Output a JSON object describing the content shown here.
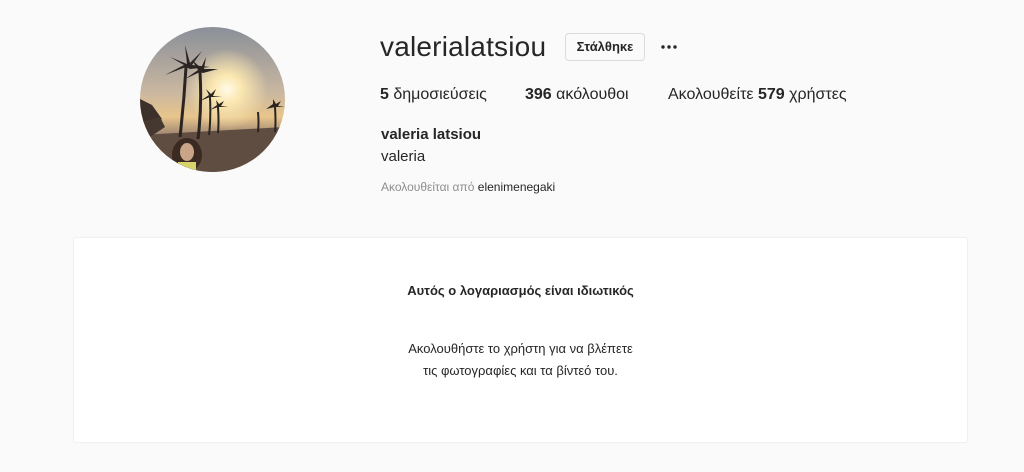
{
  "profile": {
    "username": "valerialatsiou",
    "sent_button_label": "Στάλθηκε",
    "more_icon": "more-horizontal-icon",
    "stats": {
      "posts_count": "5",
      "posts_label": "δημοσιεύσεις",
      "followers_count": "396",
      "followers_label": "ακόλουθοι",
      "following_prefix": "Ακολουθείτε",
      "following_count": "579",
      "following_suffix": "χρήστες"
    },
    "full_name": "valeria latsiou",
    "bio": "valeria",
    "followed_by_label": "Ακολουθείται από",
    "followed_by_user": "elenimenegaki"
  },
  "private_notice": {
    "title": "Αυτός ο λογαριασμός είναι ιδιωτικός",
    "text": "Ακολουθήστε το χρήστη για να βλέπετε τις φωτογραφίες και τα βίντεό του."
  },
  "colors": {
    "background": "#fafafa",
    "text": "#262626",
    "secondary_text": "#8e8e8e",
    "border": "#dbdbdb"
  }
}
